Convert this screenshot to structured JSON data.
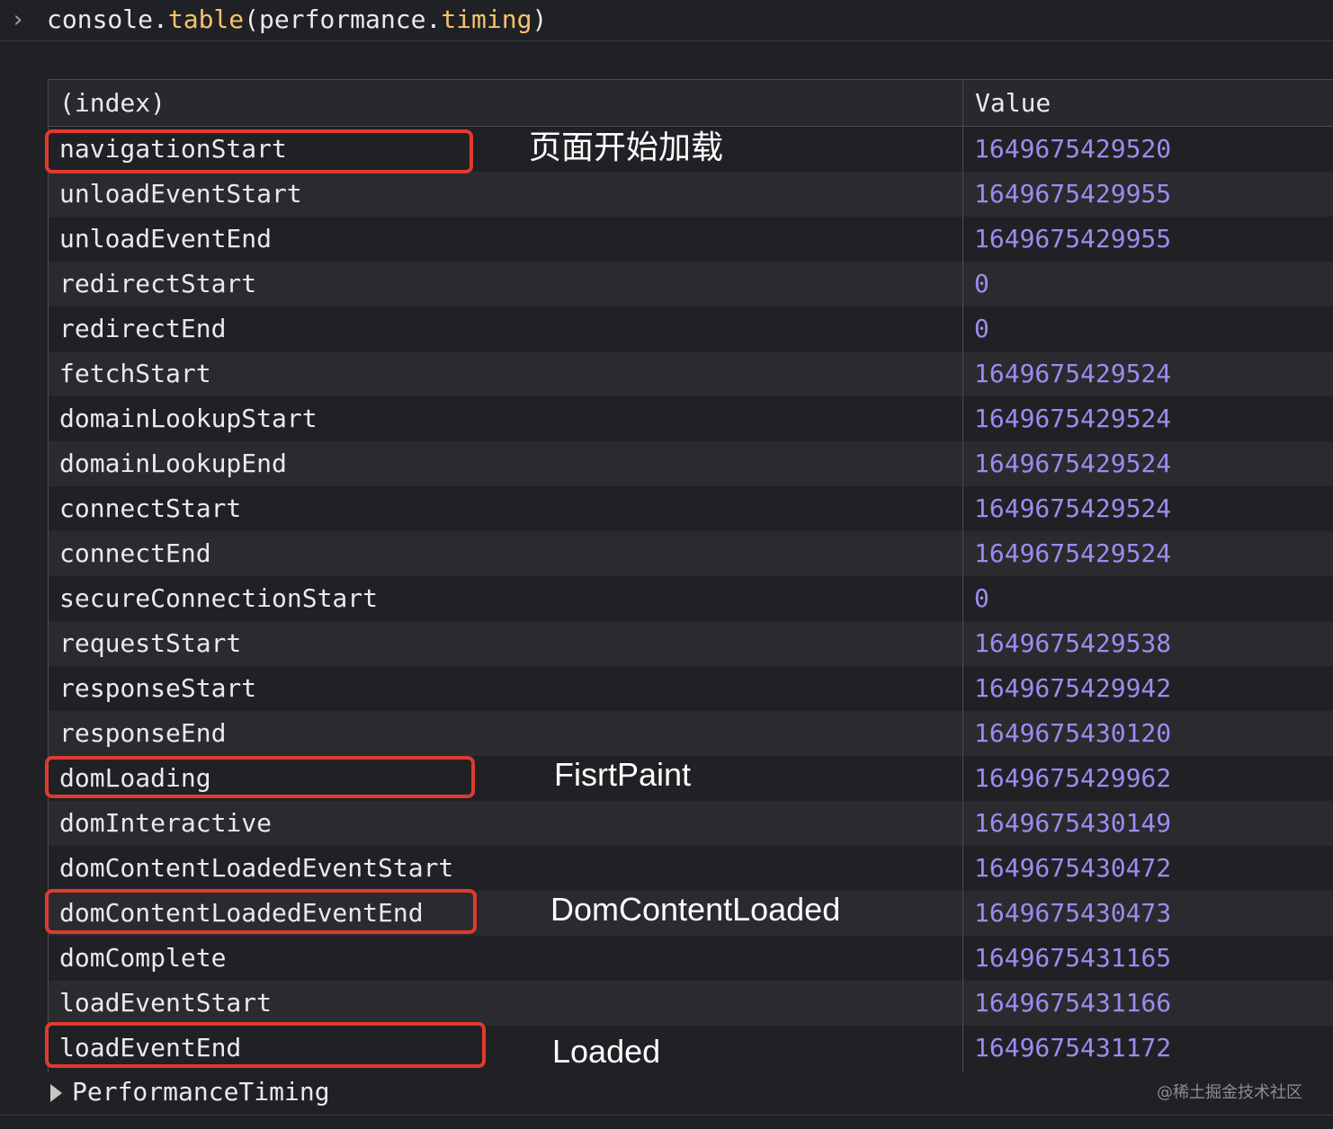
{
  "console": {
    "prompt_icon": "chevron-right-icon",
    "command_prefix": "console.",
    "command_method": "table",
    "command_open": "(performance.",
    "command_prop": "timing",
    "command_close": ")"
  },
  "table": {
    "headers": [
      "(index)",
      "Value"
    ],
    "rows": [
      {
        "key": "navigationStart",
        "value": "1649675429520"
      },
      {
        "key": "unloadEventStart",
        "value": "1649675429955"
      },
      {
        "key": "unloadEventEnd",
        "value": "1649675429955"
      },
      {
        "key": "redirectStart",
        "value": "0"
      },
      {
        "key": "redirectEnd",
        "value": "0"
      },
      {
        "key": "fetchStart",
        "value": "1649675429524"
      },
      {
        "key": "domainLookupStart",
        "value": "1649675429524"
      },
      {
        "key": "domainLookupEnd",
        "value": "1649675429524"
      },
      {
        "key": "connectStart",
        "value": "1649675429524"
      },
      {
        "key": "connectEnd",
        "value": "1649675429524"
      },
      {
        "key": "secureConnectionStart",
        "value": "0"
      },
      {
        "key": "requestStart",
        "value": "1649675429538"
      },
      {
        "key": "responseStart",
        "value": "1649675429942"
      },
      {
        "key": "responseEnd",
        "value": "1649675430120"
      },
      {
        "key": "domLoading",
        "value": "1649675429962"
      },
      {
        "key": "domInteractive",
        "value": "1649675430149"
      },
      {
        "key": "domContentLoadedEventStart",
        "value": "1649675430472"
      },
      {
        "key": "domContentLoadedEventEnd",
        "value": "1649675430473"
      },
      {
        "key": "domComplete",
        "value": "1649675431165"
      },
      {
        "key": "loadEventStart",
        "value": "1649675431166"
      },
      {
        "key": "loadEventEnd",
        "value": "1649675431172"
      }
    ]
  },
  "annotations": {
    "page_start_load": "页面开始加载",
    "first_paint": "FisrtPaint",
    "dom_content_loaded": "DomContentLoaded",
    "loaded": "Loaded"
  },
  "footer": {
    "expand_icon": "triangle-right-icon",
    "label": "PerformanceTiming",
    "watermark": "@稀土掘金技术社区"
  },
  "colors": {
    "background": "#202124",
    "value_text": "#9c8cf0",
    "method_text": "#f5c36e",
    "highlight_border": "#e03a2f"
  }
}
